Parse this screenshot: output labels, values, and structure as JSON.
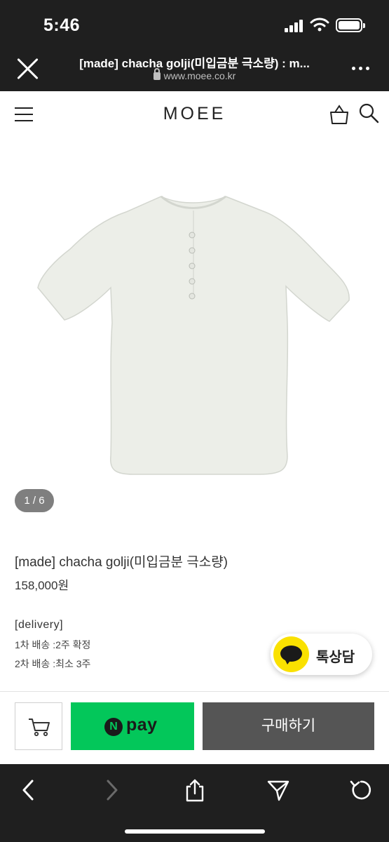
{
  "status_bar": {
    "time": "5:46"
  },
  "browser": {
    "page_title": "[made] chacha golji(미입금분 극소량) : m...",
    "url": "www.moee.co.kr"
  },
  "site": {
    "logo": "MOEE"
  },
  "gallery": {
    "pager": "1 / 6"
  },
  "product": {
    "name": "[made] chacha golji(미입금분 극소량)",
    "price": "158,000원",
    "delivery_title": "[delivery]",
    "delivery_lines": [
      "1차 배송 :2주 확정",
      "2차 배송 :최소 3주"
    ]
  },
  "talk": {
    "label": "톡상담",
    "icon_color": "#fae100"
  },
  "buy_bar": {
    "npay_n": "N",
    "npay_label": "pay",
    "purchase_label": "구매하기",
    "npay_color": "#03c75a"
  },
  "toolbar": {
    "icons": [
      "back-icon",
      "forward-icon",
      "share-icon",
      "send-icon",
      "refresh-icon"
    ]
  }
}
